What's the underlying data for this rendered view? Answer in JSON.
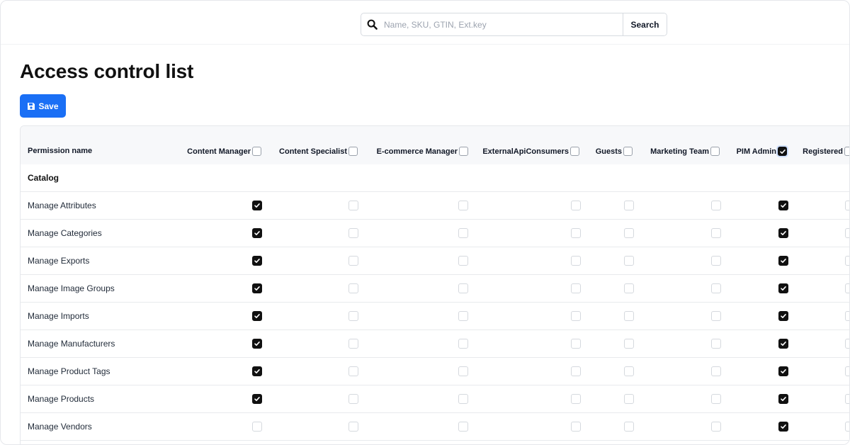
{
  "search": {
    "placeholder": "Name, SKU, GTIN, Ext.key",
    "value": "",
    "button_label": "Search"
  },
  "page": {
    "title": "Access control list",
    "save_label": "Save"
  },
  "table": {
    "first_column_header": "Permission name",
    "roles": [
      {
        "name": "Content Manager",
        "header_checked": false
      },
      {
        "name": "Content Specialist",
        "header_checked": false
      },
      {
        "name": "E-commerce Manager",
        "header_checked": false
      },
      {
        "name": "ExternalApiConsumers",
        "header_checked": false
      },
      {
        "name": "Guests",
        "header_checked": false
      },
      {
        "name": "Marketing Team",
        "header_checked": false
      },
      {
        "name": "PIM Admin",
        "header_checked": true
      },
      {
        "name": "Registered",
        "header_checked": false
      }
    ],
    "section": "Catalog",
    "permissions": [
      {
        "name": "Manage Attributes",
        "checked": [
          true,
          false,
          false,
          false,
          false,
          false,
          true,
          false
        ]
      },
      {
        "name": "Manage Categories",
        "checked": [
          true,
          false,
          false,
          false,
          false,
          false,
          true,
          false
        ]
      },
      {
        "name": "Manage Exports",
        "checked": [
          true,
          false,
          false,
          false,
          false,
          false,
          true,
          false
        ]
      },
      {
        "name": "Manage Image Groups",
        "checked": [
          true,
          false,
          false,
          false,
          false,
          false,
          true,
          false
        ]
      },
      {
        "name": "Manage Imports",
        "checked": [
          true,
          false,
          false,
          false,
          false,
          false,
          true,
          false
        ]
      },
      {
        "name": "Manage Manufacturers",
        "checked": [
          true,
          false,
          false,
          false,
          false,
          false,
          true,
          false
        ]
      },
      {
        "name": "Manage Product Tags",
        "checked": [
          true,
          false,
          false,
          false,
          false,
          false,
          true,
          false
        ]
      },
      {
        "name": "Manage Products",
        "checked": [
          true,
          false,
          false,
          false,
          false,
          false,
          true,
          false
        ]
      },
      {
        "name": "Manage Vendors",
        "checked": [
          false,
          false,
          false,
          false,
          false,
          false,
          true,
          false
        ]
      }
    ]
  },
  "colors": {
    "accent": "#1a6ff5",
    "checked": "#111111",
    "header_bg": "#f7f8fa"
  },
  "icons": {
    "search": "search-icon",
    "save": "floppy-disk-icon",
    "check": "check-icon"
  }
}
